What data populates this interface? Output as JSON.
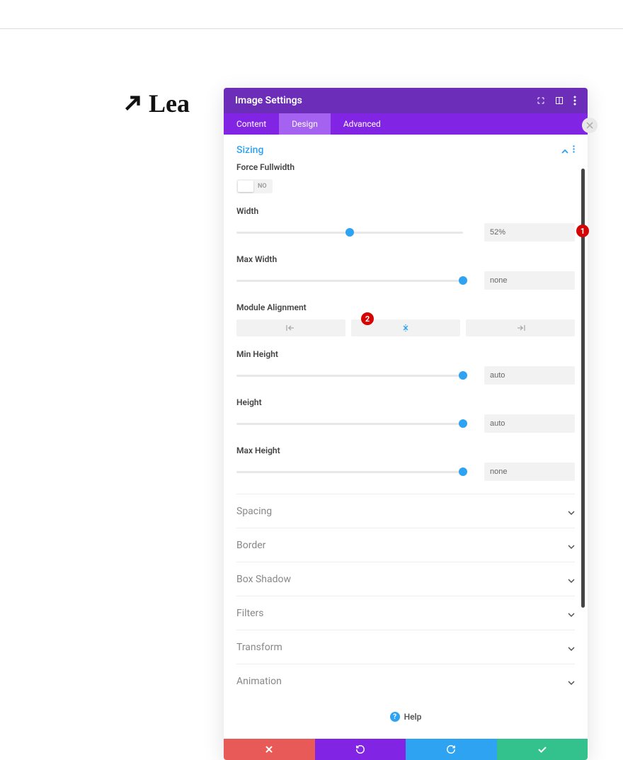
{
  "logo_text": "Lea",
  "header": {
    "title": "Image Settings"
  },
  "tabs": {
    "content": "Content",
    "design": "Design",
    "advanced": "Advanced"
  },
  "sizing": {
    "title": "Sizing",
    "force_fullwidth_label": "Force Fullwidth",
    "force_fullwidth_value": "NO",
    "width_label": "Width",
    "width_value": "52%",
    "max_width_label": "Max Width",
    "max_width_value": "none",
    "module_alignment_label": "Module Alignment",
    "min_height_label": "Min Height",
    "min_height_value": "auto",
    "height_label": "Height",
    "height_value": "auto",
    "max_height_label": "Max Height",
    "max_height_value": "none"
  },
  "collapsed": {
    "spacing": "Spacing",
    "border": "Border",
    "box_shadow": "Box Shadow",
    "filters": "Filters",
    "transform": "Transform",
    "animation": "Animation"
  },
  "help": {
    "label": "Help"
  },
  "callouts": {
    "one": "1",
    "two": "2"
  }
}
